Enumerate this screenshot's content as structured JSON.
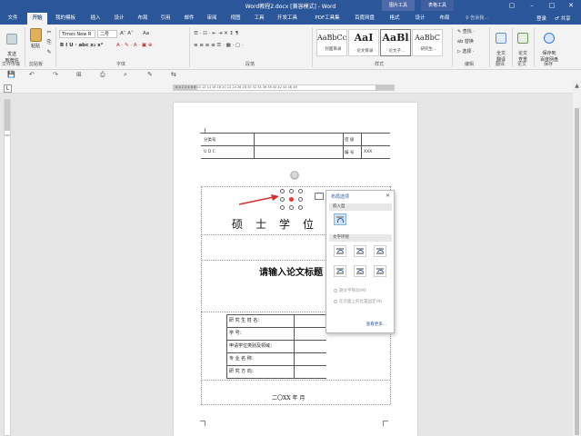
{
  "window": {
    "title": "Word教程2.docx [兼容模式] - Word",
    "context_tabs": [
      "图片工具",
      "表格工具"
    ],
    "buttons": [
      "▢",
      "–",
      "□",
      "✕"
    ]
  },
  "tabs": [
    {
      "label": "文件"
    },
    {
      "label": "开始",
      "active": true
    },
    {
      "label": "我的模板"
    },
    {
      "label": "插入"
    },
    {
      "label": "设计"
    },
    {
      "label": "布局"
    },
    {
      "label": "引用"
    },
    {
      "label": "邮件"
    },
    {
      "label": "审阅"
    },
    {
      "label": "视图"
    },
    {
      "label": "工具"
    },
    {
      "label": "开发工具"
    },
    {
      "label": "PDF工具集"
    },
    {
      "label": "百度网盘"
    },
    {
      "label": "格式"
    },
    {
      "label": "设计"
    },
    {
      "label": "布局"
    }
  ],
  "tell_me": "♀ 告诉我...",
  "login": "登录",
  "share": "♂ 共享",
  "ribbon": {
    "send_file": "发送\n到微信",
    "paste": "粘贴",
    "font_name": "Times New R",
    "font_size": "二号",
    "size_arrows": "A˄ A˅",
    "aa_label": "Aa",
    "format_row": "B  I  U  · abc  x₂  x²",
    "color_row": "A  · ✎ · A · ▣ ⊕",
    "para_row1": "☰ · ☷ · ⇤ ⇥  ✕ ↕  ¶",
    "para_row2": "≡ ≡ ≡ ≡  ☰ ·  ▦ · ▢ ·",
    "styles": [
      {
        "preview": "AaBbCc",
        "name": "· 封面目录"
      },
      {
        "preview": "AaI",
        "name": "· 论文目录"
      },
      {
        "preview": "AaBl",
        "name": "· 论文子..."
      },
      {
        "preview": "AaBbC",
        "name": "· 研究生..."
      }
    ],
    "edit_find": "✎ 查找 ·",
    "edit_replace": "ab 替换",
    "edit_select": "▷ 选择 ·",
    "translate": "全文\n翻译",
    "check": "论文\n查重",
    "save": "保存到\n百度网盘",
    "groups": [
      "文件传输",
      "剪贴板",
      "字体",
      "段落",
      "样式",
      "编辑",
      "翻译",
      "论文",
      "保存"
    ]
  },
  "qat": [
    "💾",
    "↶",
    "↷",
    "⊞",
    "⎙",
    "⌕",
    "✎",
    "⇆"
  ],
  "ruler": {
    "marks": "8  4  2     2  4  6  8  10  12  14  16  18  20  22  24  26  28  30  32  34  36  38  40  42  44  46  48",
    "corner": "L"
  },
  "doc": {
    "cls_label": "分类号",
    "udc_label": "U D C",
    "secret_label": "密 级",
    "serial_label": "编 号",
    "serial_value": "XXX",
    "title": "硕士学位论文",
    "thesis_title": "请输入论文标题",
    "form_rows": [
      "研 究 生 姓 名：",
      "学            号：",
      "申请学位类别及领域：",
      "专  业  名  称：",
      "研  究  方  向："
    ],
    "date_line": "二〇XX 年    月"
  },
  "layout_popup": {
    "title": "布局选项",
    "close": "✕",
    "inline_section": "嵌入型",
    "wrap_section": "文字环绕",
    "move_with_text": "随文字移动(M)",
    "fix_on_page": "在页面上的位置固定(N)",
    "see_more": "查看更多..."
  },
  "colors": {
    "accent": "#2b579a",
    "selection": "#e53935"
  }
}
